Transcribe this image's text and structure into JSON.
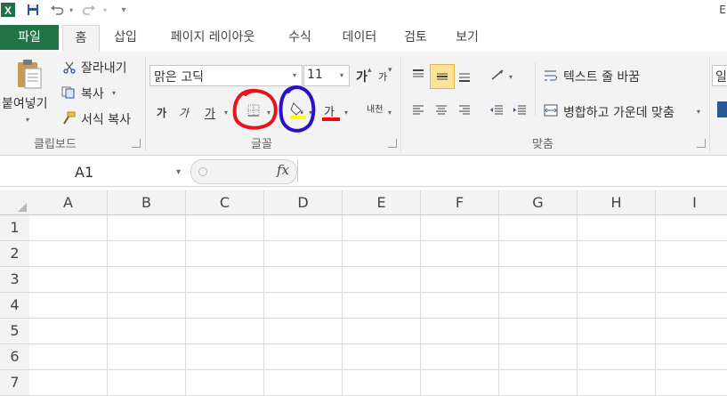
{
  "qat": {
    "right_edge_text": "E"
  },
  "tabs": [
    {
      "label": "파일"
    },
    {
      "label": "홈"
    },
    {
      "label": "삽입"
    },
    {
      "label": "페이지 레이아웃"
    },
    {
      "label": "수식"
    },
    {
      "label": "데이터"
    },
    {
      "label": "검토"
    },
    {
      "label": "보기"
    }
  ],
  "clipboard": {
    "paste_label": "붙여넣기",
    "cut_label": "잘라내기",
    "copy_label": "복사",
    "format_painter_label": "서식 복사",
    "group_label": "클립보드"
  },
  "font": {
    "font_name": "맑은 고딕",
    "font_size": "11",
    "grow_label": "가",
    "shrink_label": "가",
    "bold_label": "가",
    "italic_label": "가",
    "underline_label": "가",
    "font_color_label": "가",
    "phonetic_label": "내천",
    "group_label": "글꼴",
    "fill_color": "#ffff00",
    "font_color": "#ff0000"
  },
  "alignment": {
    "wrap_text_label": "텍스트 줄 바꿈",
    "merge_center_label": "병합하고 가운데 맞춤",
    "group_label": "맞춤"
  },
  "partial_group": {
    "label": "일"
  },
  "formula_bar": {
    "name_box": "A1",
    "fx_label": "fx",
    "formula_value": ""
  },
  "columns": [
    "A",
    "B",
    "C",
    "D",
    "E",
    "F",
    "G",
    "H",
    "I"
  ],
  "rows": [
    "1",
    "2",
    "3",
    "4",
    "5",
    "6",
    "7"
  ],
  "annotations": {
    "red_circle_color": "#e8141c",
    "blue_circle_color": "#2a10c8"
  }
}
